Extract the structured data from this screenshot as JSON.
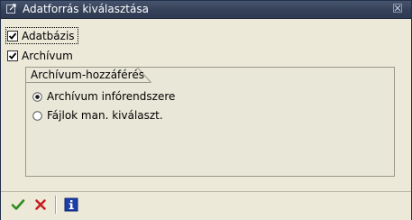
{
  "window": {
    "title": "Adatforrás kiválasztása"
  },
  "checkboxes": [
    {
      "label": "Adatbázis",
      "checked": true,
      "focused": true
    },
    {
      "label": "Archívum",
      "checked": true,
      "focused": false
    }
  ],
  "archive_group": {
    "title": "Archívum-hozzáférés",
    "options": [
      {
        "label": "Archívum infórendszere",
        "selected": true
      },
      {
        "label": "Fájlok man. kiválaszt.",
        "selected": false
      }
    ]
  },
  "toolbar": {
    "buttons": [
      {
        "icon": "checkmark-icon",
        "color": "#2f8a1e"
      },
      {
        "icon": "cancel-icon",
        "color": "#c81e1e"
      },
      {
        "icon": "info-icon",
        "color": "#1c3ea8"
      }
    ]
  },
  "colors": {
    "titlebar": "#36425a",
    "background": "#ece9d8",
    "group_background": "#e9e7d8"
  }
}
